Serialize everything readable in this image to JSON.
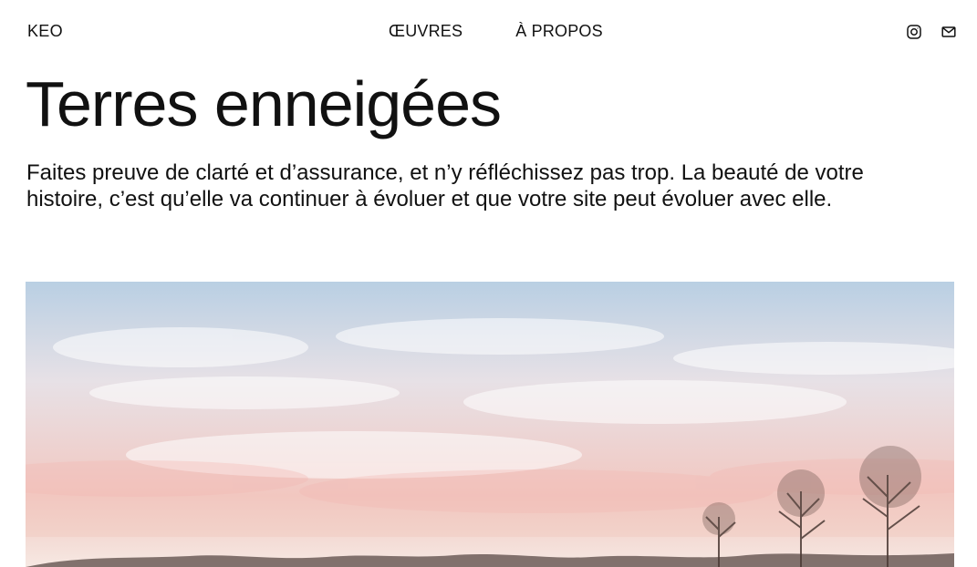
{
  "header": {
    "logo": "KEO",
    "nav": [
      {
        "label": "ŒUVRES"
      },
      {
        "label": "À PROPOS"
      }
    ],
    "social": [
      {
        "icon": "instagram-icon"
      },
      {
        "icon": "email-icon"
      }
    ]
  },
  "main": {
    "title": "Terres enneigées",
    "intro": "Faites preuve de clarté et d’assurance, et n’y réfléchissez pas trop. La beauté de votre histoire, c’est qu’elle va continuer à évoluer et que votre site peut évoluer avec elle."
  },
  "colors": {
    "text": "#111111",
    "sky_top": "#b9cfe3",
    "sky_bottom": "#f2c7c0"
  }
}
